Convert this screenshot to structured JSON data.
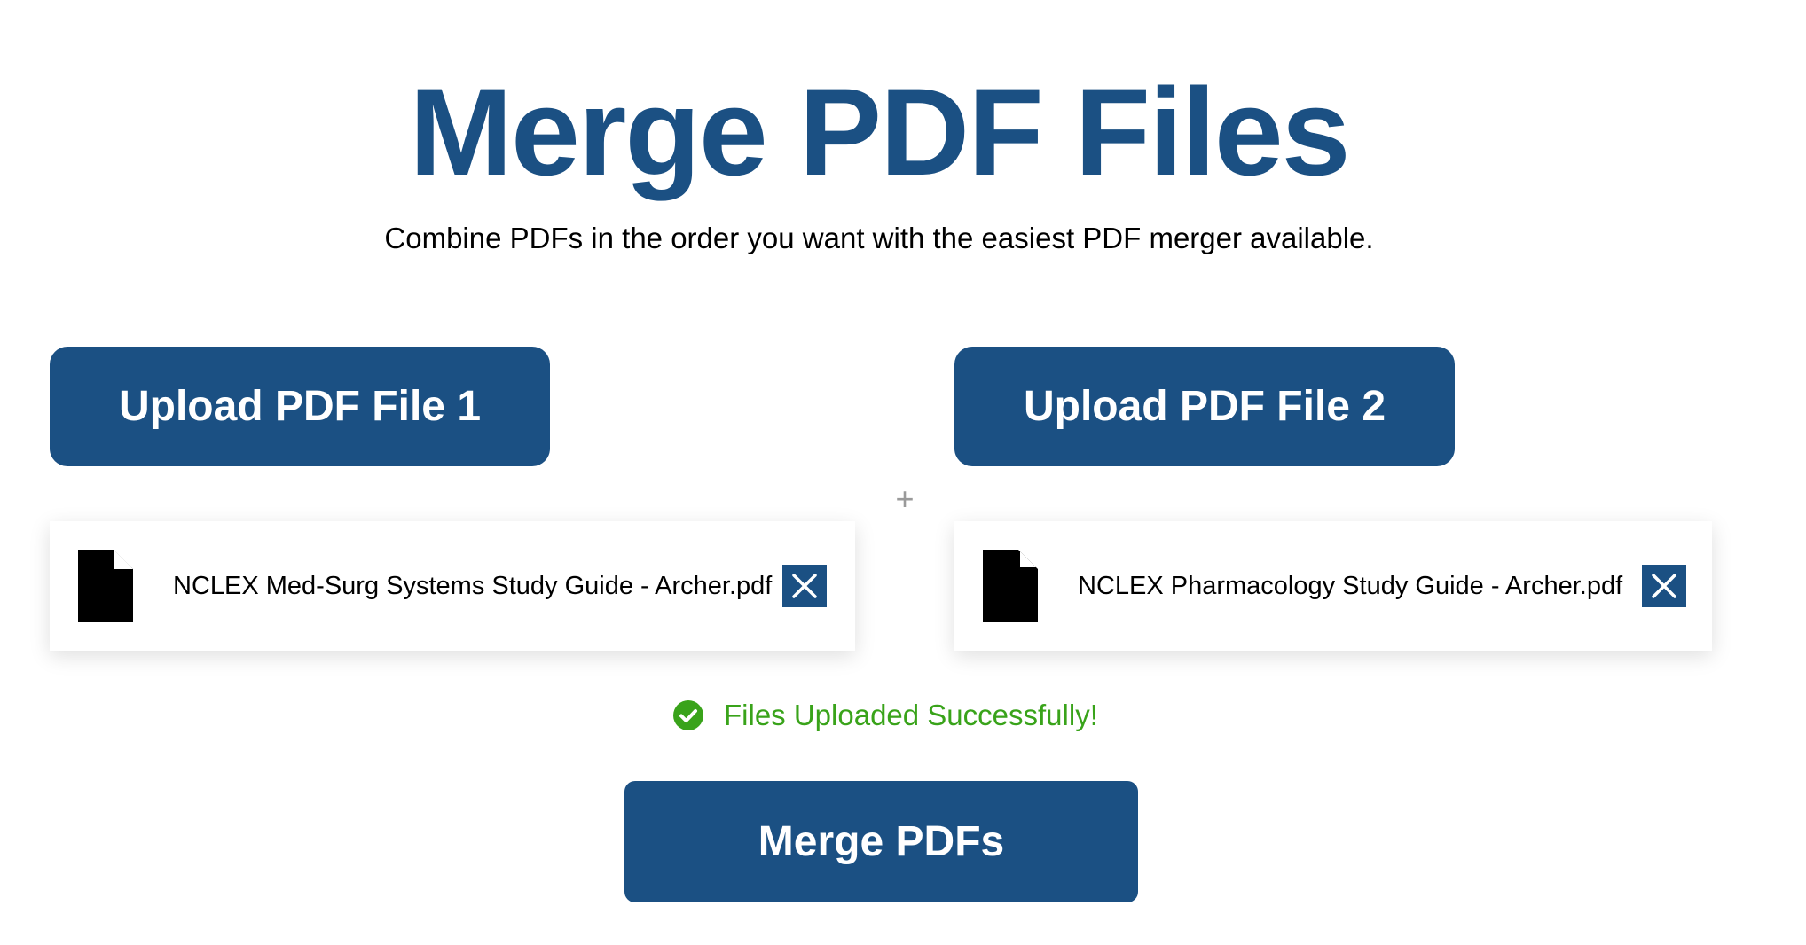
{
  "header": {
    "title": "Merge PDF Files",
    "subtitle": "Combine PDFs in the order you want with the easiest PDF merger available."
  },
  "uploads": [
    {
      "button_label": "Upload PDF File 1",
      "file_name": "NCLEX Med-Surg Systems Study Guide - Archer.pdf",
      "file_icon": "document-icon",
      "remove_icon": "close-icon"
    },
    {
      "button_label": "Upload PDF File 2",
      "file_name": "NCLEX Pharmacology Study Guide - Archer.pdf",
      "file_icon": "document-icon",
      "remove_icon": "close-icon"
    }
  ],
  "separator": "+",
  "status": {
    "icon": "check-circle-icon",
    "text": "Files Uploaded Successfully!",
    "color": "#39a31a"
  },
  "actions": {
    "merge_label": "Merge PDFs"
  },
  "colors": {
    "brand": "#1b5083",
    "success": "#39a31a"
  }
}
